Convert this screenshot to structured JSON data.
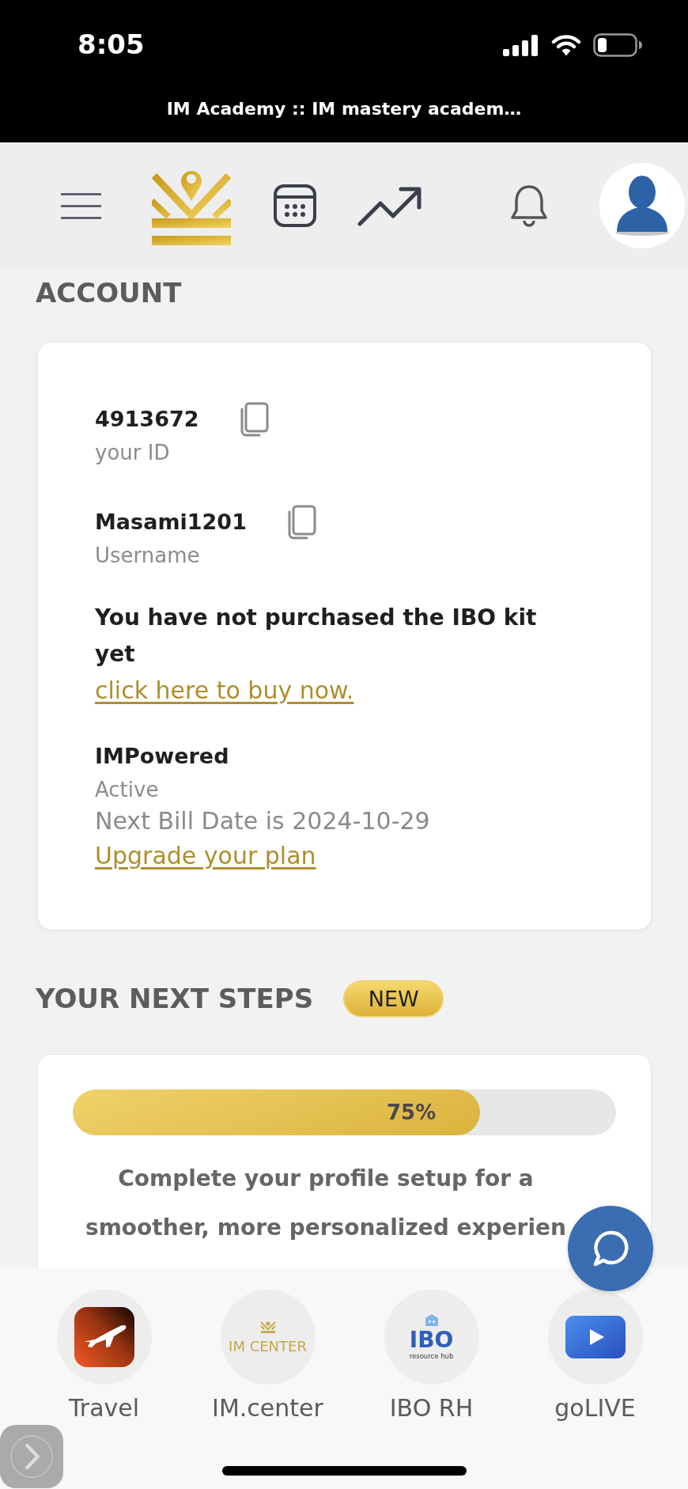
{
  "status_bar": {
    "time": "8:05"
  },
  "browser": {
    "title": "IM Academy :: IM mastery academ…"
  },
  "account": {
    "heading": "ACCOUNT",
    "ids": [
      {
        "value": "4913672",
        "label": "your ID"
      },
      {
        "value": "Masami1201",
        "label": "Username"
      }
    ],
    "kit_notice": {
      "message": "You have not purchased the IBO kit yet",
      "link": "click here to buy now."
    },
    "plan": {
      "name": "IMPowered",
      "status": "Active",
      "next_bill": "Next Bill Date is 2024-10-29",
      "link": "Upgrade your plan"
    }
  },
  "next_steps": {
    "heading": "YOUR NEXT STEPS",
    "badge": "NEW",
    "progress": {
      "level": 0.75,
      "label": "75%"
    },
    "message": "Complete your profile setup for a smoother, more personalized experien"
  },
  "bottom_nav": [
    {
      "kind": "travel",
      "label": "Travel"
    },
    {
      "kind": "logo",
      "label": "IM.center",
      "logo_text": "IM CENTER"
    },
    {
      "kind": "hub",
      "label": "IBO RH",
      "logo_text": "IBO",
      "logo_subtext": "resource hub"
    },
    {
      "kind": "video",
      "label": "goLIVE"
    }
  ]
}
